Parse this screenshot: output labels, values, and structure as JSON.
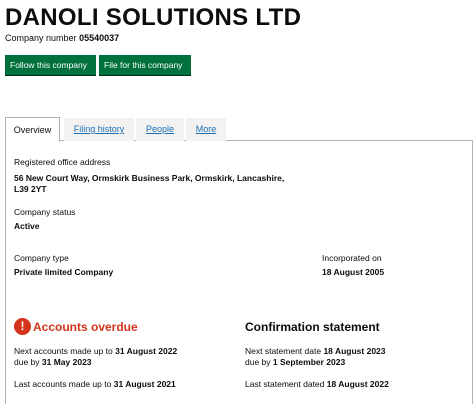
{
  "company": {
    "name": "DANOLI SOLUTIONS LTD",
    "number_label": "Company number",
    "number": "05540037"
  },
  "actions": {
    "follow_label": "Follow this company",
    "file_label": "File for this company"
  },
  "tabs": [
    {
      "label": "Overview",
      "active": true
    },
    {
      "label": "Filing history",
      "active": false
    },
    {
      "label": "People",
      "active": false
    },
    {
      "label": "More",
      "active": false
    }
  ],
  "overview": {
    "registered_office_label": "Registered office address",
    "registered_office_line1": "56 New Court Way, Ormskirk Business Park, Ormskirk, Lancashire,",
    "registered_office_line2": "L39 2YT",
    "status_label": "Company status",
    "status_value": "Active",
    "type_label": "Company type",
    "type_value": "Private limited Company",
    "incorporated_label": "Incorporated on",
    "incorporated_value": "18 August 2005"
  },
  "accounts": {
    "heading": "Accounts overdue",
    "icon": "!",
    "next_made_up_prefix": "Next accounts made up to",
    "next_made_up_date": "31 August 2022",
    "due_by_prefix": "due by",
    "due_by_date": "31 May 2023",
    "last_made_up_prefix": "Last accounts made up to",
    "last_made_up_date": "31 August 2021"
  },
  "confirmation": {
    "heading": "Confirmation statement",
    "next_prefix": "Next statement date",
    "next_date": "18 August 2023",
    "due_by_prefix": "due by",
    "due_by_date": "1 September 2023",
    "last_prefix": "Last statement dated",
    "last_date": "18 August 2022"
  },
  "colors": {
    "primary_button": "#00703c",
    "warning": "#d4351c",
    "link": "#1d70b8"
  }
}
